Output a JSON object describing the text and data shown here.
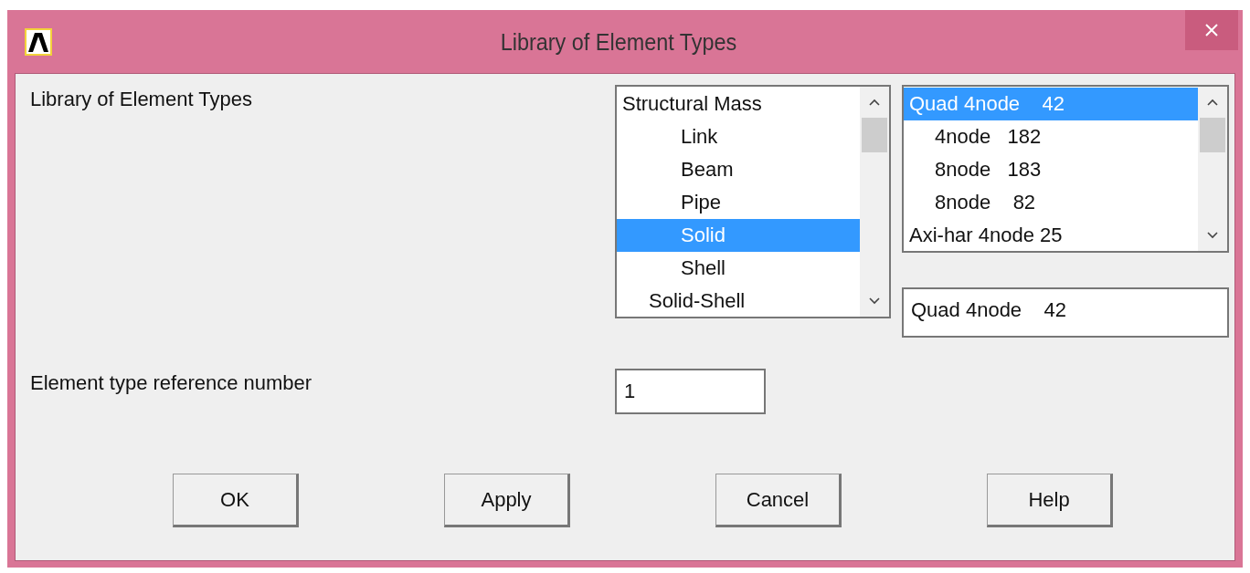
{
  "window": {
    "title": "Library of Element Types"
  },
  "library_label": "Library of Element Types",
  "category_list": {
    "items": [
      {
        "label": "Structural Mass",
        "kind": "group",
        "selected": false
      },
      {
        "label": "Link",
        "kind": "type",
        "selected": false
      },
      {
        "label": "Beam",
        "kind": "type",
        "selected": false
      },
      {
        "label": "Pipe",
        "kind": "type",
        "selected": false
      },
      {
        "label": "Solid",
        "kind": "type",
        "selected": true
      },
      {
        "label": "Shell",
        "kind": "type",
        "selected": false
      },
      {
        "label": "Solid-Shell",
        "kind": "family",
        "selected": false
      }
    ]
  },
  "type_list": {
    "items": [
      {
        "label": "Quad 4node    42",
        "kind": "group",
        "selected": true
      },
      {
        "label": "4node   182",
        "kind": "type",
        "selected": false
      },
      {
        "label": "8node   183",
        "kind": "type",
        "selected": false
      },
      {
        "label": "8node    82",
        "kind": "type",
        "selected": false
      },
      {
        "label": "Axi-har 4node 25",
        "kind": "group",
        "selected": false
      }
    ]
  },
  "selection_field": {
    "value": "Quad 4node    42"
  },
  "reference": {
    "label": "Element type reference number",
    "value": "1"
  },
  "buttons": [
    "OK",
    "Apply",
    "Cancel",
    "Help"
  ]
}
